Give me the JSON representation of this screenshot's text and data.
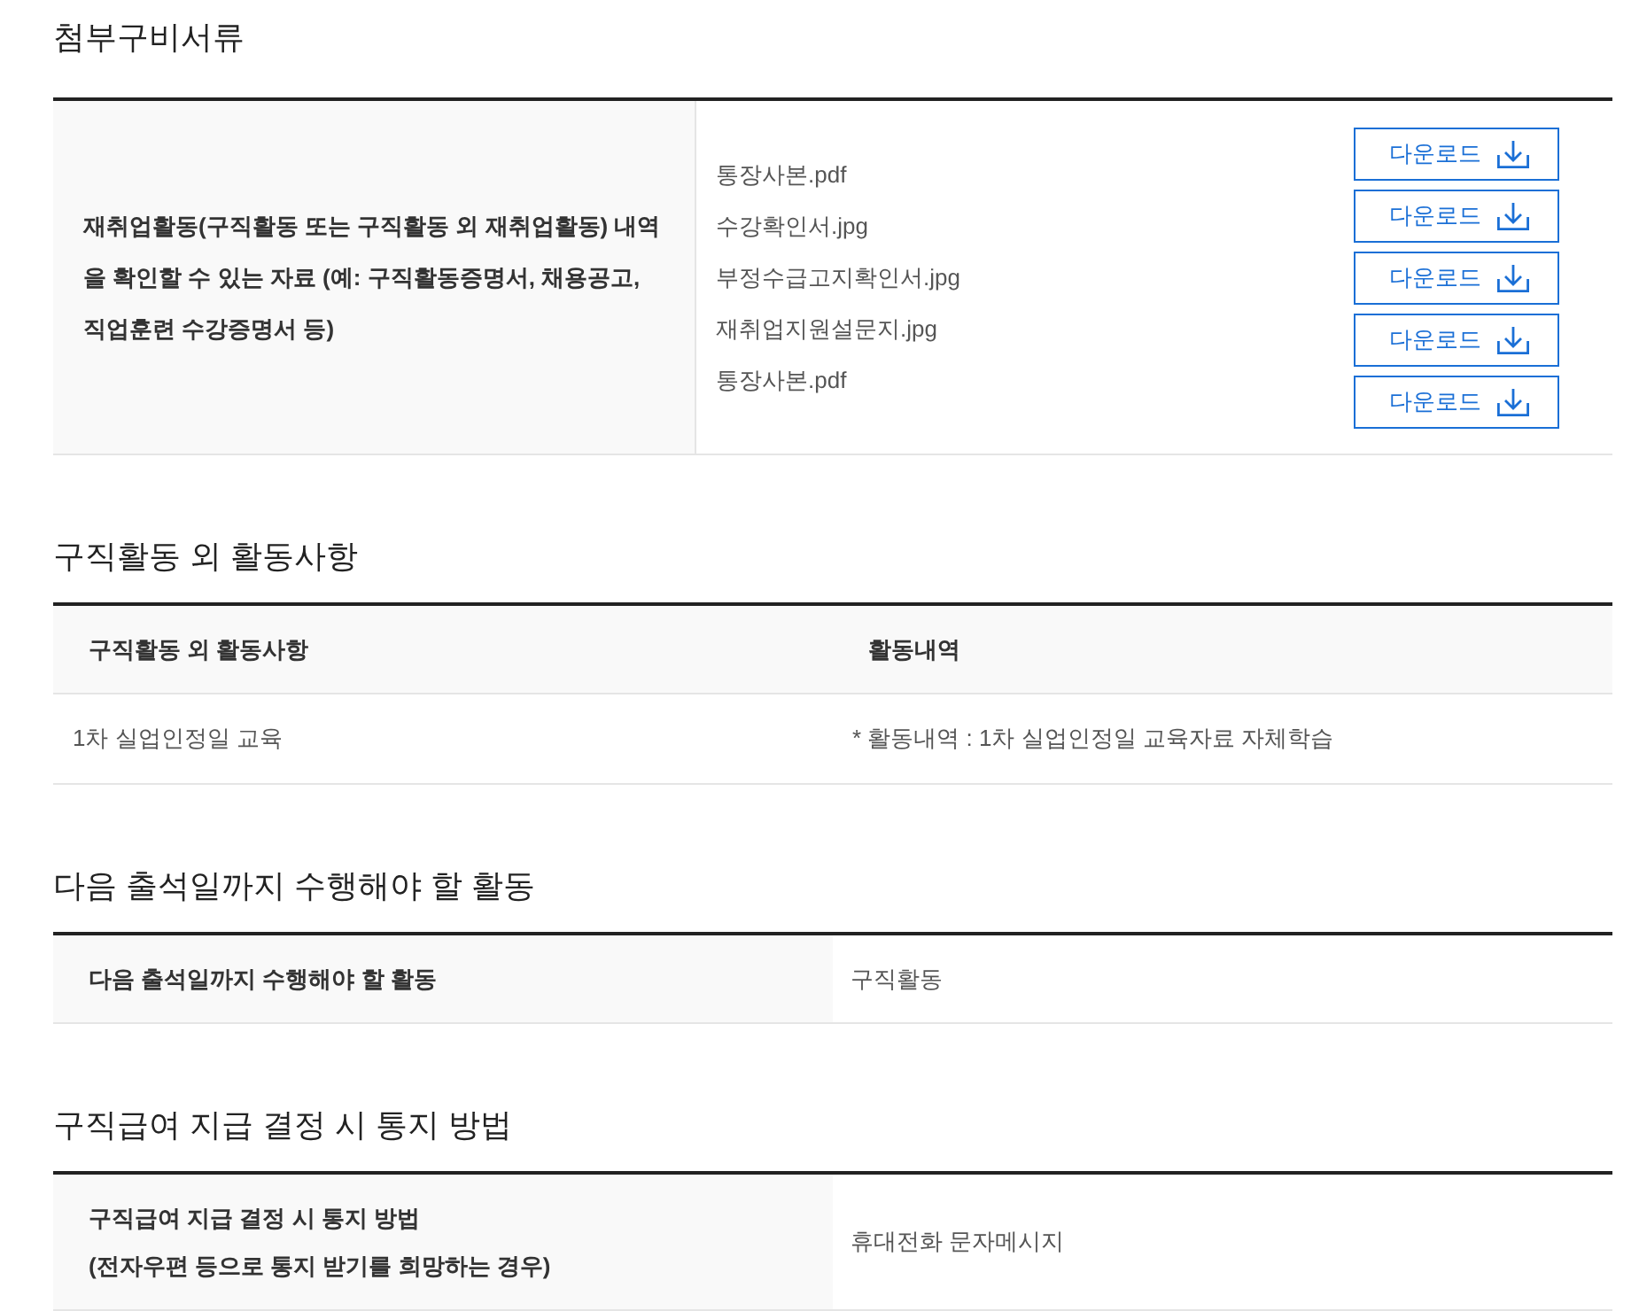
{
  "sections": [
    {
      "kind": "attachments",
      "title": "첨부구비서류",
      "label": "재취업활동(구직활동 또는 구직활동 외 재취업활동) 내역을 확인할 수 있는 자료 (예: 구직활동증명서, 채용공고, 직업훈련 수강증명서 등)",
      "files": [
        {
          "name": "통장사본.pdf",
          "button": "다운로드"
        },
        {
          "name": "수강확인서.jpg",
          "button": "다운로드"
        },
        {
          "name": "부정수급고지확인서.jpg",
          "button": "다운로드"
        },
        {
          "name": "재취업지원설문지.jpg",
          "button": "다운로드"
        },
        {
          "name": "통장사본.pdf",
          "button": "다운로드"
        }
      ]
    },
    {
      "kind": "table",
      "title": "구직활동 외 활동사항",
      "columns": [
        "구직활동 외 활동사항",
        "활동내역"
      ],
      "rows": [
        [
          "1차 실업인정일 교육",
          "* 활동내역 : 1차 실업인정일 교육자료 자체학습"
        ]
      ]
    },
    {
      "kind": "field",
      "title": "다음 출석일까지 수행해야 할 활동",
      "label_lines": [
        "다음 출석일까지 수행해야 할 활동"
      ],
      "value": "구직활동"
    },
    {
      "kind": "field",
      "title": "구직급여 지급 결정 시 통지 방법",
      "label_lines": [
        "구직급여 지급 결정 시 통지 방법",
        "(전자우편 등으로 통지 받기를 희망하는 경우)"
      ],
      "value": "휴대전화 문자메시지"
    }
  ]
}
